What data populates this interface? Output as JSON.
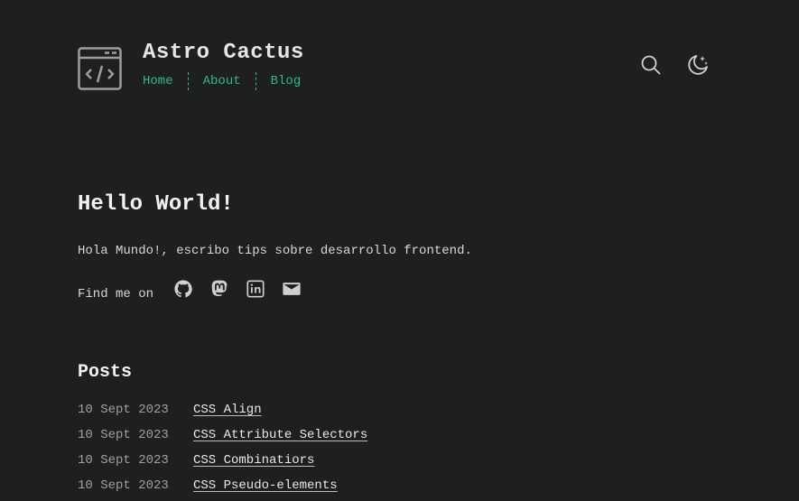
{
  "header": {
    "site_title": "Astro Cactus",
    "logo_icon": "code-window-icon",
    "nav": [
      {
        "label": "Home"
      },
      {
        "label": "About"
      },
      {
        "label": "Blog"
      }
    ],
    "search_icon": "search-icon",
    "theme_icon": "moon-stars-icon"
  },
  "hero": {
    "title": "Hello World!",
    "text": "Hola Mundo!, escribo tips sobre desarrollo frontend.",
    "find_me_label": "Find me on",
    "social": [
      {
        "icon": "github-icon"
      },
      {
        "icon": "mastodon-icon"
      },
      {
        "icon": "linkedin-icon"
      },
      {
        "icon": "email-icon"
      }
    ]
  },
  "posts": {
    "title": "Posts",
    "items": [
      {
        "date": "10 Sept 2023",
        "title": "CSS Align"
      },
      {
        "date": "10 Sept 2023",
        "title": "CSS Attribute Selectors"
      },
      {
        "date": "10 Sept 2023",
        "title": "CSS Combinatiors"
      },
      {
        "date": "10 Sept 2023",
        "title": "CSS Pseudo-elements"
      }
    ]
  },
  "colors": {
    "background": "#1d1f21",
    "accent": "#2bbc8a",
    "text": "#e5e5e5"
  }
}
